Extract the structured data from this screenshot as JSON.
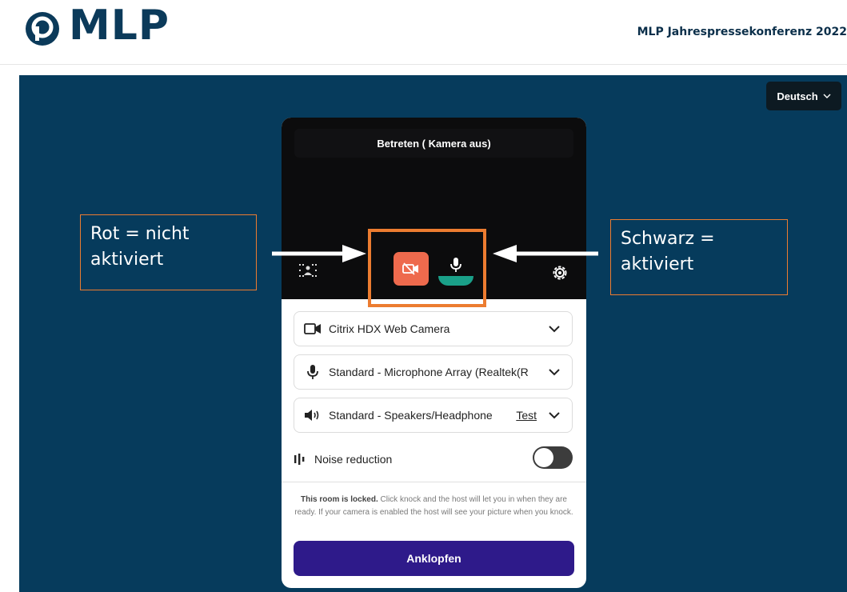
{
  "header": {
    "logo_text": "MLP",
    "event_title": "MLP Jahrespressekonferenz 2022"
  },
  "language": {
    "label": "Deutsch",
    "icon": "chevron-down-icon"
  },
  "preview": {
    "title": "Betreten ( Kamera aus)",
    "camera_state": "off",
    "mic_state": "on",
    "colors": {
      "camera_off": "#ee6a4d",
      "mic_level": "#1aa089",
      "highlight": "#ec7c30"
    }
  },
  "devices": {
    "camera": "Citrix HDX Web Camera",
    "microphone": "Standard - Microphone Array (Realtek(R",
    "speaker": "Standard - Speakers/Headphone",
    "test_label": "Test"
  },
  "noise": {
    "label": "Noise reduction",
    "enabled": false
  },
  "locked": {
    "bold": "This room is locked.",
    "text": " Click knock and the host will let you in when they are ready. If your camera is enabled the host will see your picture when you knock."
  },
  "knock_label": "Anklopfen",
  "callouts": {
    "left_line1": "Rot = nicht",
    "left_line2": "aktiviert",
    "right_line1": "Schwarz =",
    "right_line2": "aktiviert"
  }
}
